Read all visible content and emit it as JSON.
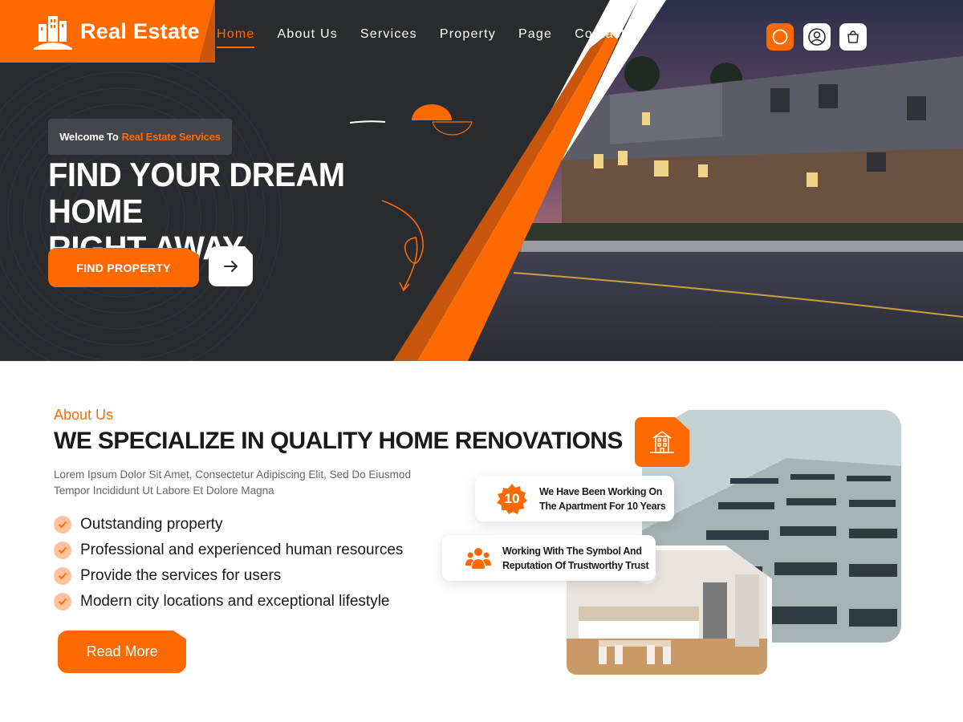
{
  "brand": {
    "name": "Real Estate"
  },
  "nav": {
    "items": [
      {
        "label": "Home",
        "active": true
      },
      {
        "label": "About Us",
        "active": false
      },
      {
        "label": "Services",
        "active": false
      },
      {
        "label": "Property",
        "active": false
      },
      {
        "label": "Page",
        "active": false
      },
      {
        "label": "Contact",
        "active": false
      }
    ]
  },
  "header_actions": {
    "icons": [
      "search-icon",
      "user-icon",
      "cart-icon"
    ]
  },
  "hero": {
    "welcome_prefix": "Welcome To",
    "welcome_highlight": "Real Estate Services",
    "title_line1": "FIND YOUR DREAM HOME",
    "title_line2": "RIGHT AWAY",
    "title_dot": ".",
    "cta_label": "FIND PROPERTY",
    "arrow_icon": "arrow-right-icon"
  },
  "about": {
    "label": "About Us",
    "title": "WE SPECIALIZE IN QUALITY HOME RENOVATIONS",
    "desc_line1": "Lorem Ipsum Dolor Sit Amet, Consectetur Adipiscing Elit, Sed Do Eiusmod",
    "desc_line2": "Tempor Incididunt Ut Labore Et Dolore Magna",
    "features": [
      "Outstanding property",
      "Professional and experienced human resources",
      "Provide the services for users",
      "Modern city locations and exceptional lifestyle"
    ],
    "read_more_label": "Read More",
    "card1": {
      "badge": "10",
      "line1": "We Have Been Working On",
      "line2": "The Apartment For 10 Years"
    },
    "card2": {
      "line1": "Working With The Symbol And",
      "line2": "Reputation Of Trustworthy Trust"
    }
  },
  "colors": {
    "accent": "#ff6a00",
    "dark": "#2a2b2f",
    "text": "#1a1a1a"
  }
}
